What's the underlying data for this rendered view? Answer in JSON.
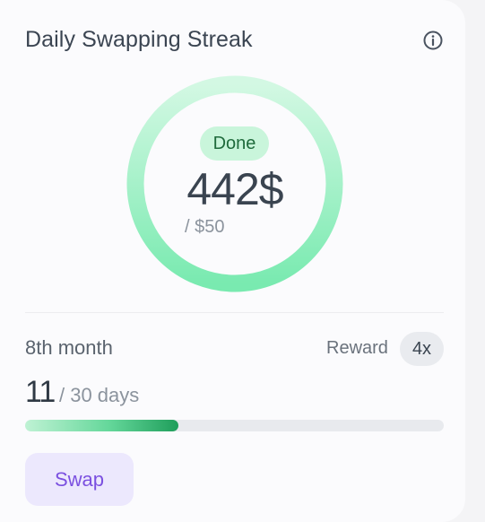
{
  "card": {
    "title": "Daily Swapping Streak",
    "info_icon": "info-circle-icon"
  },
  "goal": {
    "status": "Done",
    "amount": "442$",
    "target": "/ $50",
    "ring_progress": 1.0,
    "colors": {
      "ring_start": "#d3f8e3",
      "ring_end": "#79eab0"
    }
  },
  "streak": {
    "period": "8th month",
    "reward_label": "Reward",
    "multiplier": "4x",
    "days_done": "11",
    "days_total": "/ 30 days",
    "progress": 0.367
  },
  "actions": {
    "swap_label": "Swap"
  },
  "colors": {
    "accent": "#7b50e0",
    "success": "#1f9e5b"
  }
}
